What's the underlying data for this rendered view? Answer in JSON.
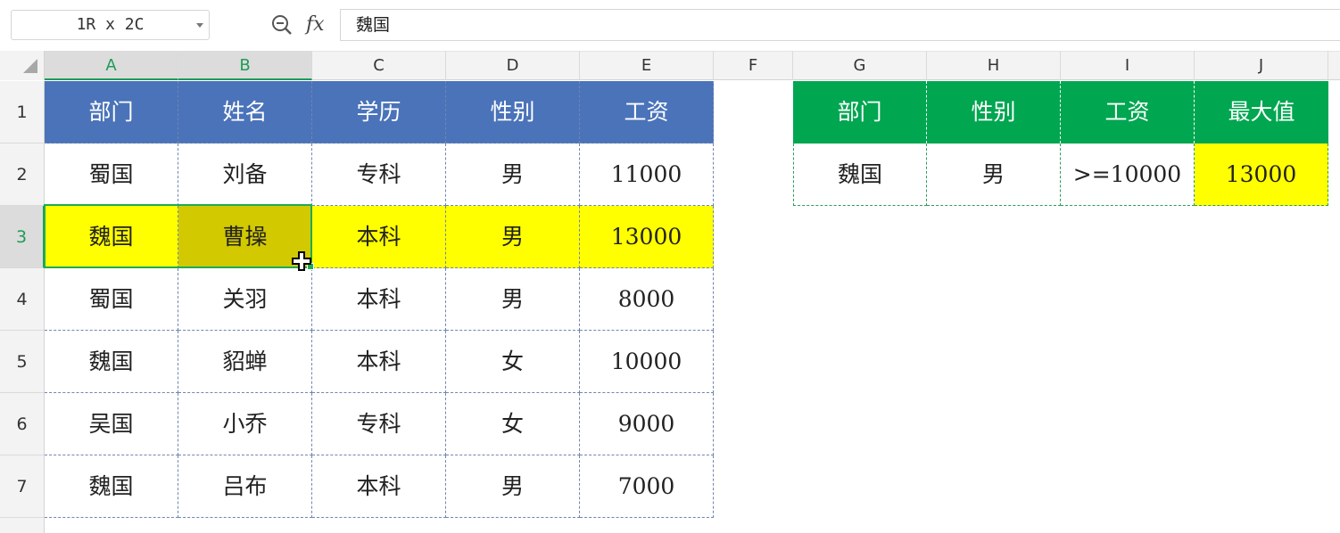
{
  "formula_bar": {
    "name_box": "1R x 2C",
    "zoom_icon": "zoom-out-icon",
    "fx_label": "fx",
    "formula_value": "魏国"
  },
  "columns": [
    "A",
    "B",
    "C",
    "D",
    "E",
    "F",
    "G",
    "H",
    "I",
    "J"
  ],
  "rows": [
    "1",
    "2",
    "3",
    "4",
    "5",
    "6",
    "7"
  ],
  "main_table": {
    "headers": [
      "部门",
      "姓名",
      "学历",
      "性别",
      "工资"
    ],
    "data": [
      [
        "蜀国",
        "刘备",
        "专科",
        "男",
        "11000"
      ],
      [
        "魏国",
        "曹操",
        "本科",
        "男",
        "13000"
      ],
      [
        "蜀国",
        "关羽",
        "本科",
        "男",
        "8000"
      ],
      [
        "魏国",
        "貂蝉",
        "本科",
        "女",
        "10000"
      ],
      [
        "吴国",
        "小乔",
        "专科",
        "女",
        "9000"
      ],
      [
        "魏国",
        "吕布",
        "本科",
        "男",
        "7000"
      ]
    ]
  },
  "criteria_table": {
    "headers": [
      "部门",
      "性别",
      "工资",
      "最大值"
    ],
    "data": [
      [
        "魏国",
        "男",
        ">=10000",
        "13000"
      ]
    ]
  },
  "colors": {
    "header_blue": "#4a73b9",
    "header_green": "#00a650",
    "highlight_yellow": "#ffff00",
    "selection_green": "#1faa55"
  },
  "cursor_icon": "move-cross-cursor-icon"
}
